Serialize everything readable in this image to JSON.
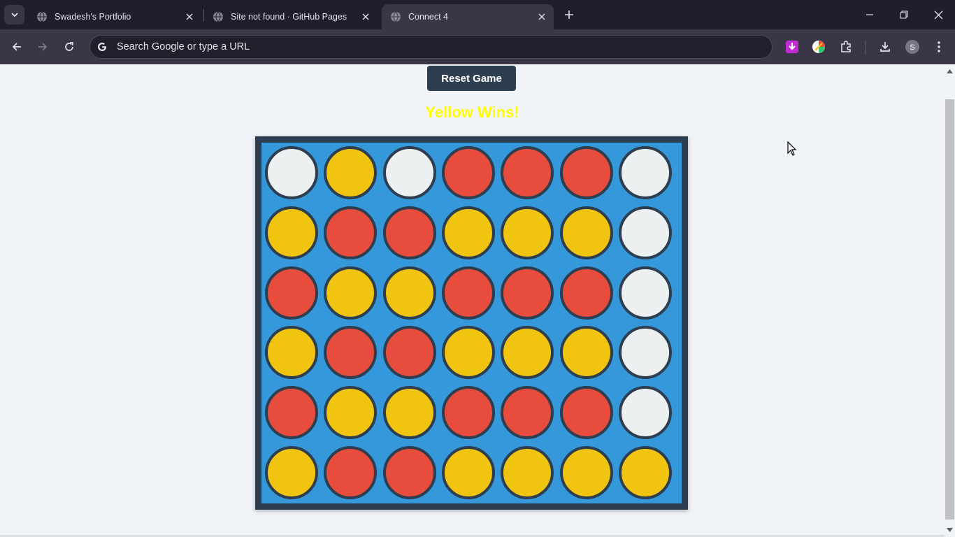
{
  "browser": {
    "tabs": [
      {
        "title": "Swadesh's Portfolio",
        "active": false
      },
      {
        "title": "Site not found · GitHub Pages",
        "active": false
      },
      {
        "title": "Connect 4",
        "active": true
      }
    ],
    "omnibox_placeholder": "Search Google or type a URL",
    "avatar_letter": "S"
  },
  "game": {
    "reset_label": "Reset Game",
    "status_text": "Yellow Wins!",
    "status_color": "#ffff00",
    "colors": {
      "empty": "#ecf0f1",
      "red": "#e74c3c",
      "yellow": "#f1c40f",
      "board": "#3498db",
      "frame": "#2c3e50"
    },
    "grid": [
      [
        "empty",
        "yellow",
        "empty",
        "red",
        "red",
        "red",
        "empty"
      ],
      [
        "yellow",
        "red",
        "red",
        "yellow",
        "yellow",
        "yellow",
        "empty"
      ],
      [
        "red",
        "yellow",
        "yellow",
        "red",
        "red",
        "red",
        "empty"
      ],
      [
        "yellow",
        "red",
        "red",
        "yellow",
        "yellow",
        "yellow",
        "empty"
      ],
      [
        "red",
        "yellow",
        "yellow",
        "red",
        "red",
        "red",
        "empty"
      ],
      [
        "yellow",
        "red",
        "red",
        "yellow",
        "yellow",
        "yellow",
        "yellow"
      ]
    ]
  }
}
